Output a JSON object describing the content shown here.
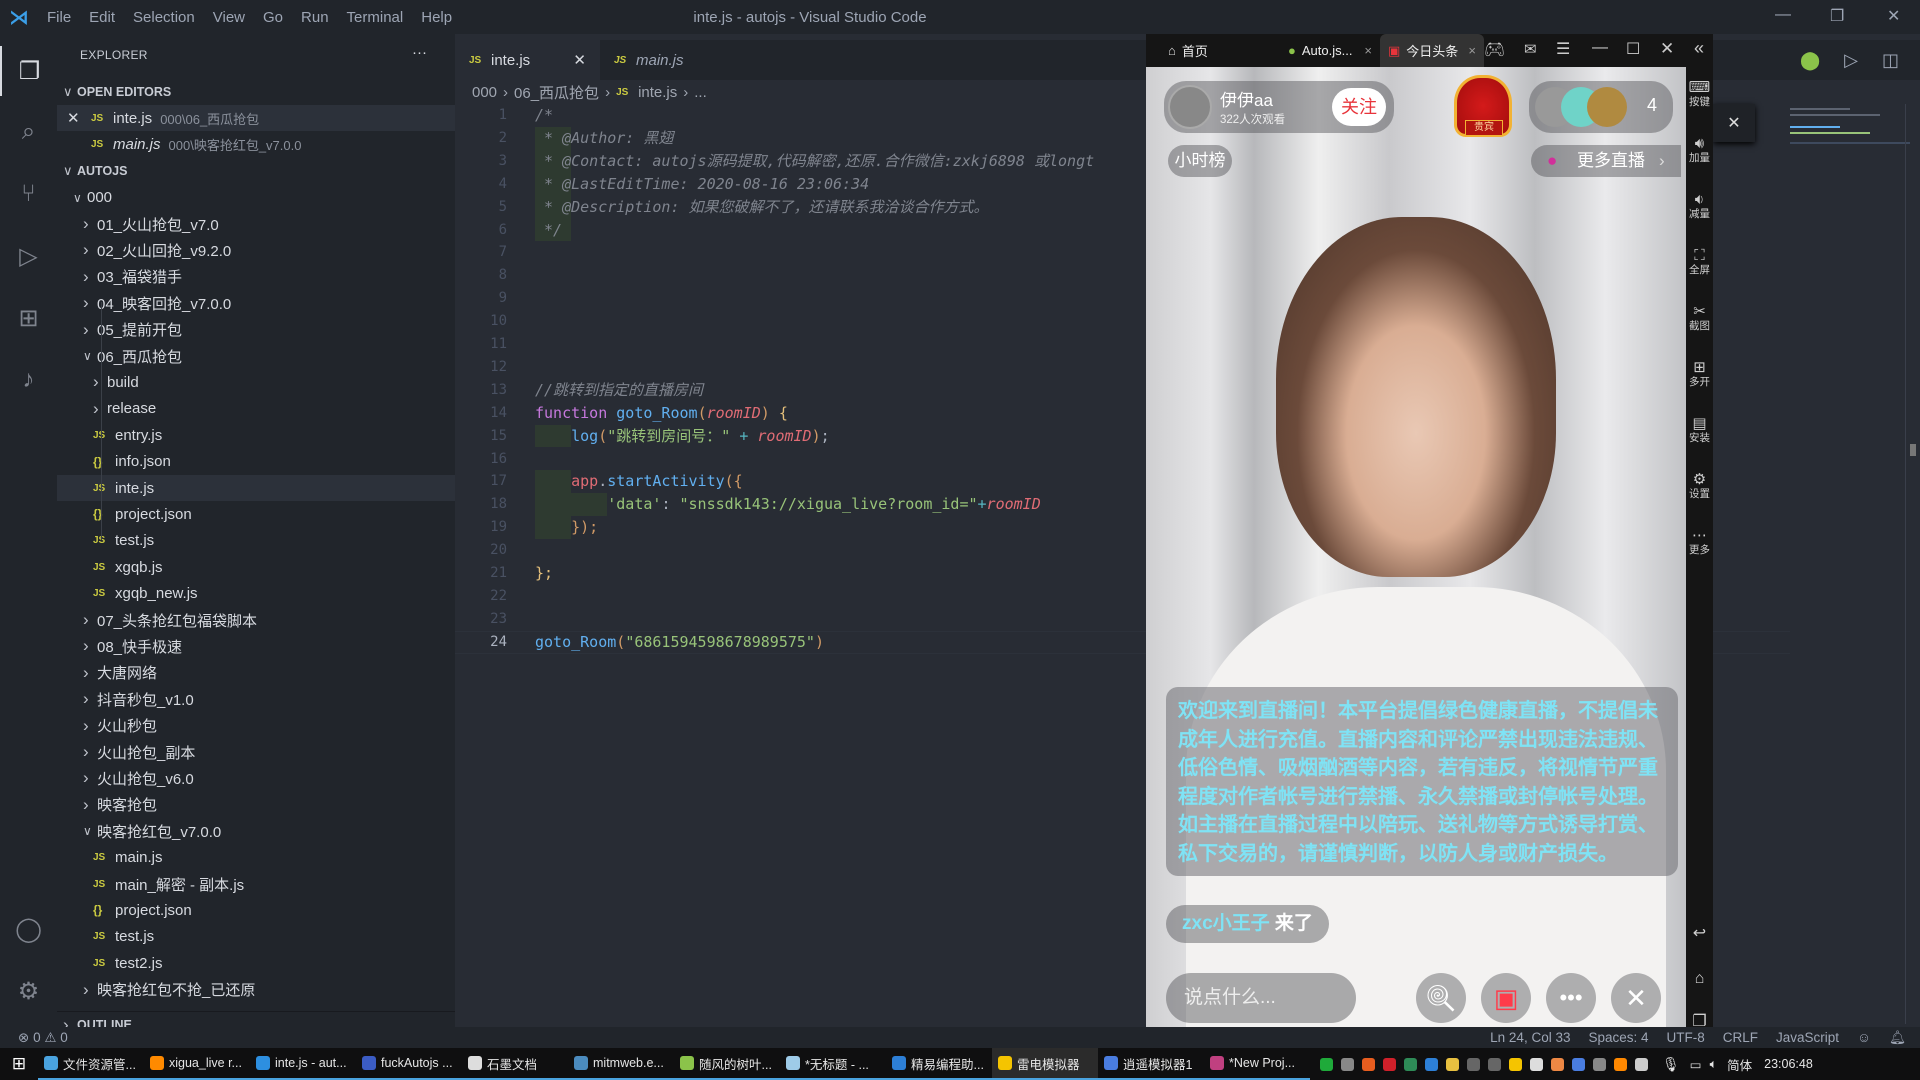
{
  "titlebar": {
    "menus": [
      "File",
      "Edit",
      "Selection",
      "View",
      "Go",
      "Run",
      "Terminal",
      "Help"
    ],
    "window_title": "inte.js - autojs - Visual Studio Code"
  },
  "sidebar": {
    "header": "EXPLORER",
    "more_icon": "ellipsis-icon",
    "open_editors_label": "OPEN EDITORS",
    "open_editors": [
      {
        "name": "inte.js",
        "path": "000\\06_西瓜抢包",
        "italic": false
      },
      {
        "name": "main.js",
        "path": "000\\映客抢红包_v7.0.0",
        "italic": true
      }
    ],
    "workspace_label": "AUTOJS",
    "tree": [
      {
        "label": "000",
        "depth": 0,
        "type": "folder-open"
      },
      {
        "label": "01_火山抢包_v7.0",
        "depth": 1,
        "type": "folder"
      },
      {
        "label": "02_火山回抢_v9.2.0",
        "depth": 1,
        "type": "folder"
      },
      {
        "label": "03_福袋猎手",
        "depth": 1,
        "type": "folder"
      },
      {
        "label": "04_映客回抢_v7.0.0",
        "depth": 1,
        "type": "folder"
      },
      {
        "label": "05_提前开包",
        "depth": 1,
        "type": "folder"
      },
      {
        "label": "06_西瓜抢包",
        "depth": 1,
        "type": "folder-open"
      },
      {
        "label": "build",
        "depth": 2,
        "type": "folder"
      },
      {
        "label": "release",
        "depth": 2,
        "type": "folder"
      },
      {
        "label": "entry.js",
        "depth": 2,
        "type": "js"
      },
      {
        "label": "info.json",
        "depth": 2,
        "type": "json"
      },
      {
        "label": "inte.js",
        "depth": 2,
        "type": "js",
        "selected": true
      },
      {
        "label": "project.json",
        "depth": 2,
        "type": "json"
      },
      {
        "label": "test.js",
        "depth": 2,
        "type": "js"
      },
      {
        "label": "xgqb.js",
        "depth": 2,
        "type": "js"
      },
      {
        "label": "xgqb_new.js",
        "depth": 2,
        "type": "js"
      },
      {
        "label": "07_头条抢红包福袋脚本",
        "depth": 1,
        "type": "folder"
      },
      {
        "label": "08_快手极速",
        "depth": 1,
        "type": "folder"
      },
      {
        "label": "大唐网络",
        "depth": 1,
        "type": "folder"
      },
      {
        "label": "抖音秒包_v1.0",
        "depth": 1,
        "type": "folder"
      },
      {
        "label": "火山秒包",
        "depth": 1,
        "type": "folder"
      },
      {
        "label": "火山抢包_副本",
        "depth": 1,
        "type": "folder"
      },
      {
        "label": "火山抢包_v6.0",
        "depth": 1,
        "type": "folder"
      },
      {
        "label": "映客抢包",
        "depth": 1,
        "type": "folder"
      },
      {
        "label": "映客抢红包_v7.0.0",
        "depth": 1,
        "type": "folder-open"
      },
      {
        "label": "main.js",
        "depth": 2,
        "type": "js"
      },
      {
        "label": "main_解密 - 副本.js",
        "depth": 2,
        "type": "js"
      },
      {
        "label": "project.json",
        "depth": 2,
        "type": "json"
      },
      {
        "label": "test.js",
        "depth": 2,
        "type": "js"
      },
      {
        "label": "test2.js",
        "depth": 2,
        "type": "js"
      },
      {
        "label": "映客抢红包不抢_已还原",
        "depth": 1,
        "type": "folder"
      }
    ],
    "outline_label": "OUTLINE"
  },
  "editor": {
    "tabs": [
      {
        "label": "inte.js",
        "active": true
      },
      {
        "label": "main.js",
        "active": false
      }
    ],
    "breadcrumb": [
      "000",
      "06_西瓜抢包",
      "inte.js",
      "..."
    ],
    "lines": [
      [
        [
          "/*",
          "com"
        ]
      ],
      [
        [
          " * @Author: 黑翅",
          "com"
        ]
      ],
      [
        [
          " * @Contact: autojs源码提取,代码解密,还原.合作微信:zxkj6898 或longt",
          "com"
        ]
      ],
      [
        [
          " * @LastEditTime: 2020-08-16 23:06:34",
          "com"
        ]
      ],
      [
        [
          " * @Description: 如果您破解不了，还请联系我洽谈合作方式。",
          "com"
        ]
      ],
      [
        [
          " */",
          "com"
        ]
      ],
      [],
      [],
      [],
      [],
      [],
      [],
      [
        [
          "//跳转到指定的直播房间",
          "com"
        ]
      ],
      [
        [
          "function ",
          "kw"
        ],
        [
          "goto_Room",
          "fn"
        ],
        [
          "(",
          "br"
        ],
        [
          "roomID",
          "par"
        ],
        [
          ")",
          "br"
        ],
        [
          " {",
          "y"
        ]
      ],
      [
        [
          "    ",
          "p"
        ],
        [
          "log",
          "fn"
        ],
        [
          "(",
          "br"
        ],
        [
          "\"跳转到房间号：\"",
          "str"
        ],
        [
          " + ",
          "op"
        ],
        [
          "roomID",
          "par"
        ],
        [
          ")",
          "br"
        ],
        [
          ";",
          "p"
        ]
      ],
      [],
      [
        [
          "    ",
          "p"
        ],
        [
          "app",
          "var"
        ],
        [
          ".",
          "p"
        ],
        [
          "startActivity",
          "fn"
        ],
        [
          "({",
          "br"
        ]
      ],
      [
        [
          "        ",
          "p"
        ],
        [
          "'data'",
          "str"
        ],
        [
          ": ",
          "p"
        ],
        [
          "\"snssdk143://xigua_live?room_id=\"",
          "str"
        ],
        [
          "+",
          "op"
        ],
        [
          "roomID",
          "par"
        ]
      ],
      [
        [
          "    ",
          "p"
        ],
        [
          "});",
          "br"
        ]
      ],
      [],
      [
        [
          "};",
          "y"
        ]
      ],
      [],
      [],
      [
        [
          "goto_Room",
          "fn"
        ],
        [
          "(",
          "br"
        ],
        [
          "\"6861594598678989575\"",
          "str"
        ],
        [
          ")",
          "br"
        ]
      ]
    ]
  },
  "statusbar": {
    "errors": "0",
    "warnings": "0",
    "position": "Ln 24, Col 33",
    "spaces": "Spaces: 4",
    "encoding": "UTF-8",
    "eol": "CRLF",
    "language": "JavaScript"
  },
  "emulator": {
    "tabs": [
      {
        "label": "首页",
        "icon": "home-icon"
      },
      {
        "label": "Auto.js...",
        "icon": "android-icon",
        "closable": true
      },
      {
        "label": "今日头条",
        "icon": "toutiao-icon",
        "closable": true,
        "active": true
      }
    ],
    "side_buttons": [
      "按键",
      "加量",
      "减量",
      "全屏",
      "截图",
      "多开",
      "安装",
      "设置",
      "更多"
    ],
    "streamer_name": "伊伊aa",
    "viewers": "322人次观看",
    "follow_label": "关注",
    "vip_badge": "贵宾",
    "audience_count": "4",
    "hour_rank": "小时榜",
    "more_live": "更多直播",
    "notice": "欢迎来到直播间！本平台提倡绿色健康直播，不提倡未成年人进行充值。直播内容和评论严禁出现违法违规、低俗色情、吸烟酗酒等内容，若有违反，将视情节严重程度对作者帐号进行禁播、永久禁播或封停帐号处理。 如主播在直播过程中以陪玩、送礼物等方式诱导打赏、私下交易的，请谨慎判断，以防人身或财产损失。",
    "join_user": "zxc小王子",
    "join_text": " 来了",
    "comment_placeholder": "说点什么..."
  },
  "taskbar": {
    "items": [
      {
        "label": "文件资源管...",
        "color": "#4aa3df"
      },
      {
        "label": "xigua_live r...",
        "color": "#ff8a00"
      },
      {
        "label": "inte.js - aut...",
        "color": "#2d8fe0"
      },
      {
        "label": "fuckAutojs ...",
        "color": "#3b5cc4"
      },
      {
        "label": "石墨文档",
        "color": "#dddddd"
      },
      {
        "label": "mitmweb.e...",
        "color": "#4b8bbe"
      },
      {
        "label": "随风的树叶...",
        "color": "#8bc34a"
      },
      {
        "label": "*无标题 - ...",
        "color": "#9ecbe8"
      },
      {
        "label": "精易编程助...",
        "color": "#2d7fd6"
      },
      {
        "label": "雷电模拟器",
        "color": "#f5c400",
        "active": true
      },
      {
        "label": "逍遥模拟器1",
        "color": "#4a7de0"
      },
      {
        "label": "*New Proj...",
        "color": "#c04080"
      }
    ],
    "ime": "简体",
    "time": "23:06:48"
  }
}
